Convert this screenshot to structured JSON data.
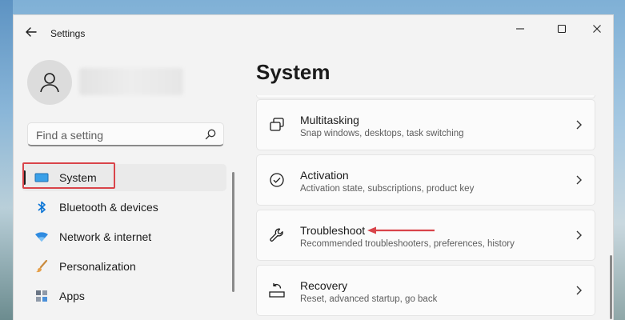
{
  "window": {
    "title": "Settings",
    "controls": {
      "minimize": "minimize-icon",
      "maximize": "maximize-icon",
      "close": "close-icon"
    }
  },
  "search": {
    "placeholder": "Find a setting"
  },
  "sidebar": {
    "items": [
      {
        "label": "System",
        "icon": "system-display-icon",
        "selected": true
      },
      {
        "label": "Bluetooth & devices",
        "icon": "bluetooth-icon"
      },
      {
        "label": "Network & internet",
        "icon": "wifi-icon"
      },
      {
        "label": "Personalization",
        "icon": "brush-icon"
      },
      {
        "label": "Apps",
        "icon": "apps-icon"
      }
    ]
  },
  "main": {
    "title": "System",
    "cards": [
      {
        "title": "Multitasking",
        "subtitle": "Snap windows, desktops, task switching",
        "icon": "multitasking-icon"
      },
      {
        "title": "Activation",
        "subtitle": "Activation state, subscriptions, product key",
        "icon": "activation-check-icon"
      },
      {
        "title": "Troubleshoot",
        "subtitle": "Recommended troubleshooters, preferences, history",
        "icon": "wrench-icon"
      },
      {
        "title": "Recovery",
        "subtitle": "Reset, advanced startup, go back",
        "icon": "recovery-icon"
      }
    ]
  },
  "annotations": {
    "highlight_color": "#d9444a",
    "arrow_color": "#d9444a"
  },
  "colors": {
    "accent": "#0067c0",
    "window_bg": "#f3f3f3",
    "card_bg": "#fbfbfb"
  }
}
